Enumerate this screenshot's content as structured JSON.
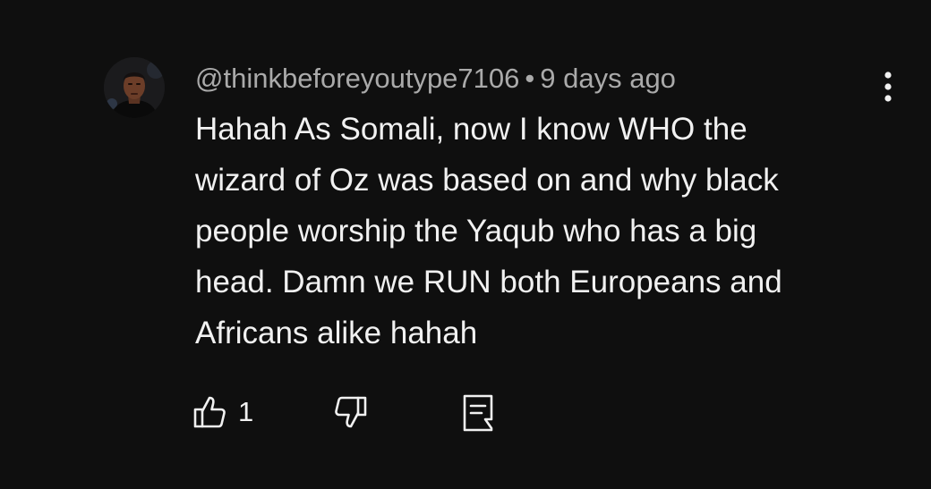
{
  "comment": {
    "author": "@thinkbeforeyoutype7106",
    "separator": "•",
    "time": "9 days ago",
    "text_lines": [
      "Hahah As Somali, now I know WHO the",
      "wizard of Oz was based on and why black",
      "people worship the Yaqub who has a big",
      "head. Damn we RUN both Europeans and",
      "Africans alike hahah"
    ],
    "like_count": "1"
  },
  "icons": {
    "avatar": "avatar",
    "more": "more-vert-icon",
    "like": "thumbs-up-icon",
    "dislike": "thumbs-down-icon",
    "reply": "reply-comment-icon"
  },
  "colors": {
    "background": "#0f0f0f",
    "text_primary": "#f1f1f1",
    "text_secondary": "#aaaaaa"
  }
}
